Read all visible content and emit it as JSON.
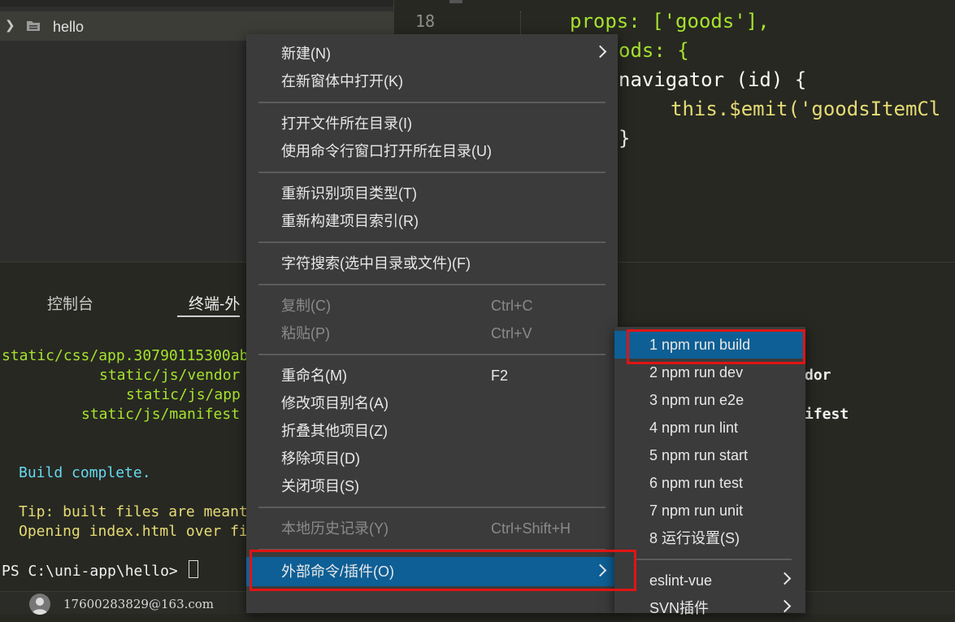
{
  "sidebar": {
    "project_name": "hello"
  },
  "editor": {
    "line_number": "18",
    "code_lines": [
      "props: ['goods'],",
      "ods: {",
      "navigator (id) {",
      "this.$emit('goodsItemCl",
      "}"
    ]
  },
  "panel": {
    "tabs": [
      "控制台",
      "终端-外"
    ],
    "terminal_lines": [
      "static/css/app.30790115300ab",
      "static/js/vendor",
      "static/js/app",
      "static/js/manifest",
      "dor",
      "ifest",
      "Build complete.",
      "Tip: built files are meant",
      "Opening index.html over fi",
      "PS C:\\uni-app\\hello> "
    ]
  },
  "status_bar": {
    "user_email": "17600283829@163.com"
  },
  "context_menu": {
    "items": [
      {
        "label": "新建(N)",
        "shortcut": "",
        "disabled": false,
        "submenu": true
      },
      {
        "label": "在新窗体中打开(K)",
        "shortcut": "",
        "disabled": false
      },
      {
        "label": "打开文件所在目录(I)",
        "shortcut": "",
        "disabled": false
      },
      {
        "label": "使用命令行窗口打开所在目录(U)",
        "shortcut": "",
        "disabled": false
      },
      {
        "label": "重新识别项目类型(T)",
        "shortcut": "",
        "disabled": false
      },
      {
        "label": "重新构建项目索引(R)",
        "shortcut": "",
        "disabled": false
      },
      {
        "label": "字符搜索(选中目录或文件)(F)",
        "shortcut": "",
        "disabled": false
      },
      {
        "label": "复制(C)",
        "shortcut": "Ctrl+C",
        "disabled": true
      },
      {
        "label": "粘贴(P)",
        "shortcut": "Ctrl+V",
        "disabled": true
      },
      {
        "label": "重命名(M)",
        "shortcut": "F2",
        "disabled": false
      },
      {
        "label": "修改项目别名(A)",
        "shortcut": "",
        "disabled": false
      },
      {
        "label": "折叠其他项目(Z)",
        "shortcut": "",
        "disabled": false
      },
      {
        "label": "移除项目(D)",
        "shortcut": "",
        "disabled": false
      },
      {
        "label": "关闭项目(S)",
        "shortcut": "",
        "disabled": false
      },
      {
        "label": "本地历史记录(Y)",
        "shortcut": "Ctrl+Shift+H",
        "disabled": true
      },
      {
        "label": "外部命令/插件(O)",
        "shortcut": "",
        "disabled": false,
        "submenu": true,
        "highlighted": true
      }
    ]
  },
  "submenu": {
    "items": [
      {
        "label": "1 npm run build",
        "highlighted": true
      },
      {
        "label": "2 npm run dev"
      },
      {
        "label": "3 npm run e2e"
      },
      {
        "label": "4 npm run lint"
      },
      {
        "label": "5 npm run start"
      },
      {
        "label": "6 npm run test"
      },
      {
        "label": "7 npm run unit"
      },
      {
        "label": "8 运行设置(S)"
      },
      {
        "label": "eslint-vue",
        "submenu": true
      },
      {
        "label": "SVN插件",
        "submenu": true
      }
    ]
  },
  "colors": {
    "highlight": "#0e5f95",
    "annotation_box": "#e01414",
    "code_keyword": "#f92672",
    "code_string": "#e6db74",
    "code_param": "#fd971f",
    "code_method": "#a6e22e",
    "terminal_green": "#a6e22e",
    "terminal_blue": "#66d9ef",
    "terminal_yellow": "#e6db74"
  }
}
